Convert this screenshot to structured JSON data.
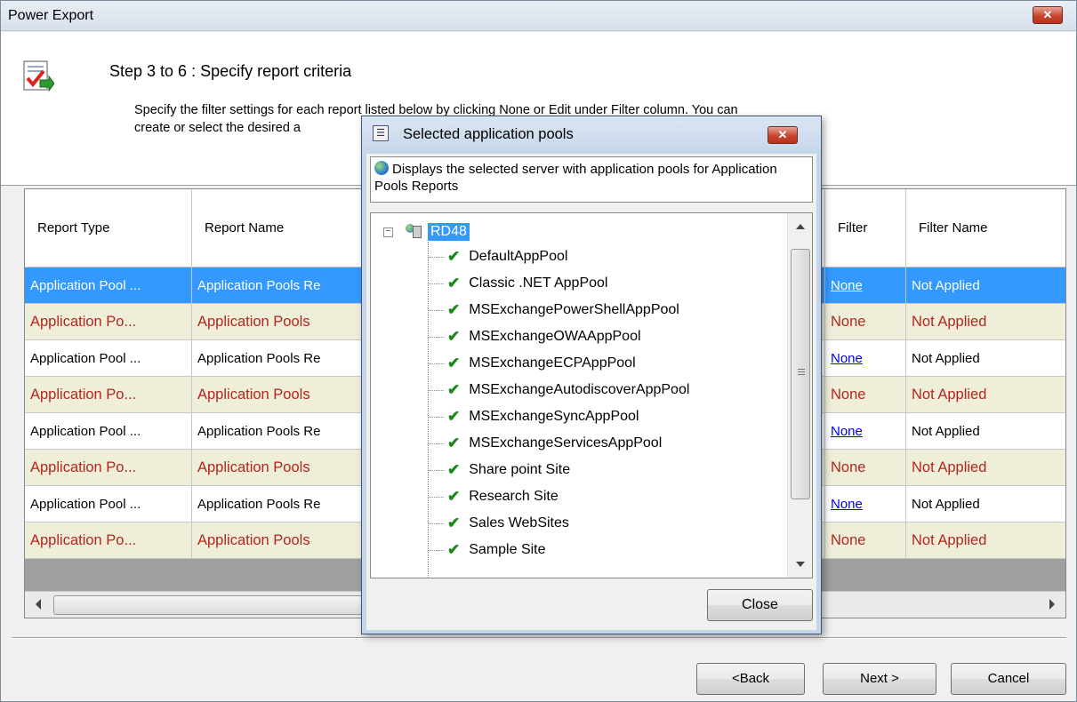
{
  "window": {
    "title": "Power Export",
    "close_label": "✕"
  },
  "header": {
    "step": "Step 3 to 6 : Specify report criteria",
    "description_line1": "Specify the filter settings for each report listed below by clicking None or Edit under Filter column. You can",
    "description_line2": "create or select the desired a"
  },
  "grid": {
    "columns": [
      "Report Type",
      "Report Name",
      "Filter",
      "Filter Name"
    ],
    "rows": [
      {
        "type": "Application Pool ...",
        "name": "Application Pools Re",
        "filter": "None",
        "filter_name": "Not Applied"
      },
      {
        "type": "Application Po...",
        "name": "Application Pools",
        "filter": "None",
        "filter_name": "Not Applied"
      },
      {
        "type": "Application Pool ...",
        "name": "Application Pools Re",
        "filter": "None",
        "filter_name": "Not Applied"
      },
      {
        "type": "Application Po...",
        "name": "Application Pools",
        "filter": "None",
        "filter_name": "Not Applied"
      },
      {
        "type": "Application Pool ...",
        "name": "Application Pools Re",
        "filter": "None",
        "filter_name": "Not Applied"
      },
      {
        "type": "Application Po...",
        "name": "Application Pools",
        "filter": "None",
        "filter_name": "Not Applied"
      },
      {
        "type": "Application Pool ...",
        "name": "Application Pools Re",
        "filter": "None",
        "filter_name": "Not Applied"
      },
      {
        "type": "Application Po...",
        "name": "Application Pools",
        "filter": "None",
        "filter_name": "Not Applied"
      }
    ]
  },
  "buttons": {
    "back": "<Back",
    "next": "Next >",
    "cancel": "Cancel"
  },
  "dialog": {
    "title": "Selected application pools",
    "info": "Displays the selected server with application pools for Application Pools Reports",
    "server": "RD48",
    "pools": [
      "DefaultAppPool",
      "Classic .NET AppPool",
      "MSExchangePowerShellAppPool",
      "MSExchangeOWAAppPool",
      "MSExchangeECPAppPool",
      "MSExchangeAutodiscoverAppPool",
      "MSExchangeSyncAppPool",
      "MSExchangeServicesAppPool",
      "Share point Site",
      "Research Site",
      "Sales WebSites",
      "Sample Site"
    ],
    "close_label": "Close"
  }
}
